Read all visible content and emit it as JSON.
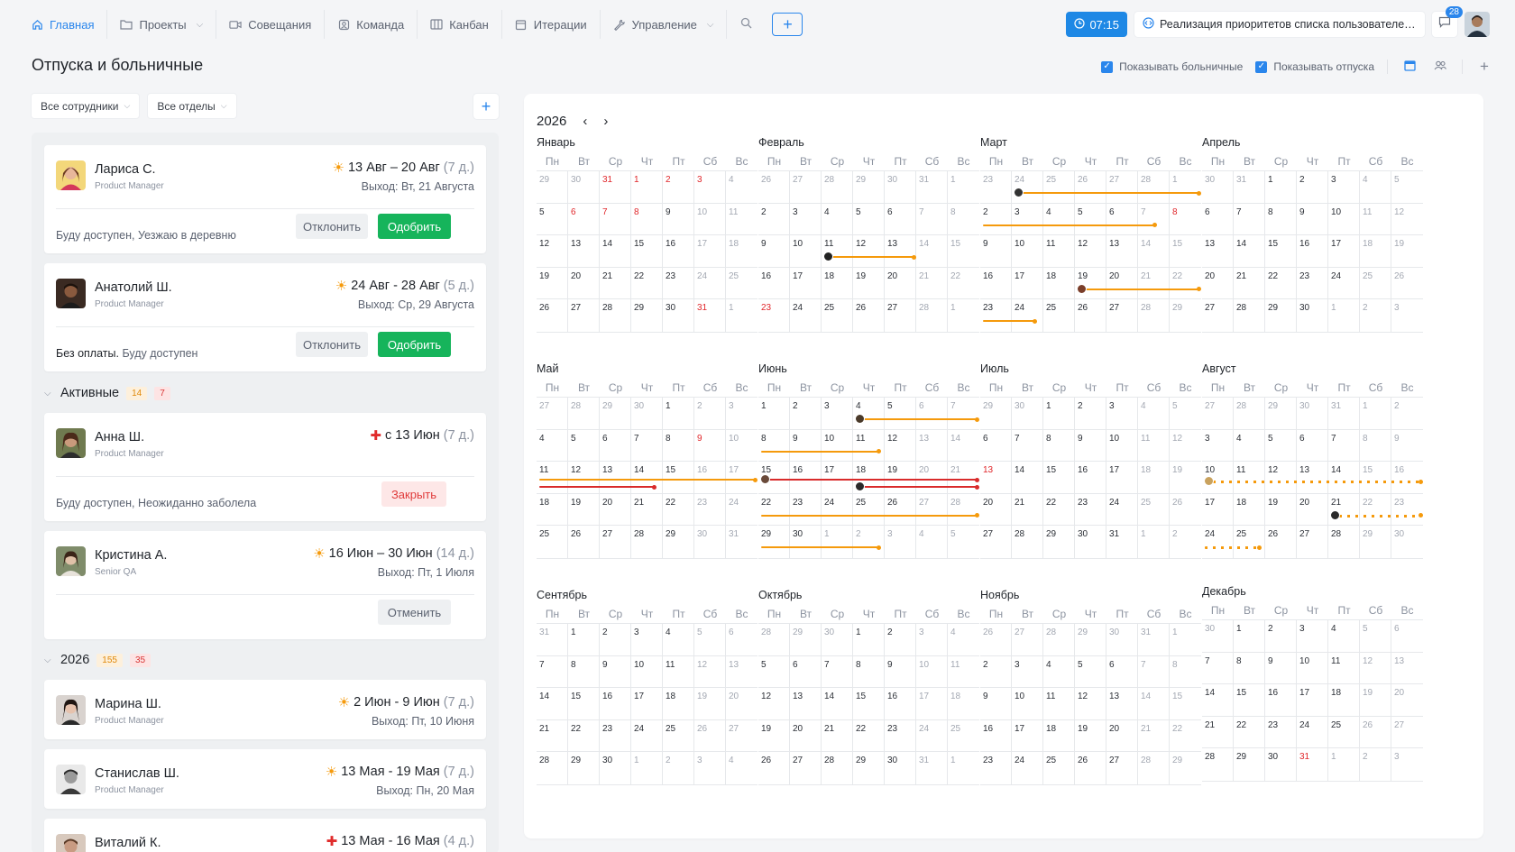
{
  "nav": {
    "items": [
      {
        "label": "Главная",
        "icon": "home-icon",
        "active": true
      },
      {
        "label": "Проекты",
        "icon": "folder-icon",
        "dropdown": true
      },
      {
        "label": "Совещания",
        "icon": "video-icon"
      },
      {
        "label": "Команда",
        "icon": "team-icon"
      },
      {
        "label": "Канбан",
        "icon": "kanban-icon"
      },
      {
        "label": "Итерации",
        "icon": "calendar-icon"
      },
      {
        "label": "Управление",
        "icon": "wrench-icon",
        "dropdown": true
      }
    ],
    "timer": "07:15",
    "current_task": "Реализация приоритетов списка пользователей д...",
    "notifications": "28"
  },
  "page": {
    "title": "Отпуска и больничные",
    "show_sick": "Показывать больничные",
    "show_vacations": "Показывать отпуска"
  },
  "filters": {
    "employees": "Все сотрудники",
    "departments": "Все отделы"
  },
  "pending": [
    {
      "name": "Лариса С.",
      "role": "Product Manager",
      "type": "vacation",
      "dates": "13 Авг – 20 Авг",
      "duration": "(7 д.)",
      "return": "Выход: Вт, 21 Августа",
      "note_prefix": "",
      "note": "Буду доступен, Уезжаю в деревню",
      "reject": "Отклонить",
      "approve": "Одобрить"
    },
    {
      "name": "Анатолий Ш.",
      "role": "Product Manager",
      "type": "vacation",
      "dates": "24 Авг - 28 Авг",
      "duration": "(5 д.)",
      "return": "Выход: Ср, 29 Августа",
      "note_prefix": "Без оплаты.",
      "note": " Буду доступен",
      "reject": "Отклонить",
      "approve": "Одобрить"
    }
  ],
  "groups": {
    "active": {
      "title": "Активные",
      "count_vac": "14",
      "count_sick": "7"
    },
    "year": {
      "title": "2026",
      "count_vac": "155",
      "count_sick": "35"
    }
  },
  "active_items": [
    {
      "name": "Анна Ш.",
      "role": "Product Manager",
      "type": "sick",
      "dates": "с 13 Июн",
      "duration": "(7 д.)",
      "note": "Буду доступен, Неожиданно заболела",
      "action": "Закрыть"
    },
    {
      "name": "Кристина А.",
      "role": "Senior QA",
      "type": "vacation",
      "dates": "16 Июн – 30 Июн",
      "duration": "(14 д.)",
      "return": "Выход: Пт, 1 Июля",
      "action": "Отменить"
    }
  ],
  "year_items": [
    {
      "name": "Марина Ш.",
      "role": "Product Manager",
      "type": "vacation",
      "dates": "2 Июн - 9 Июн",
      "duration": "(7 д.)",
      "return": "Выход: Пт, 10 Июня"
    },
    {
      "name": "Станислав Ш.",
      "role": "Product Manager",
      "type": "vacation",
      "dates": "13 Мая - 19 Мая",
      "duration": "(7 д.)",
      "return": "Выход: Пн, 20 Мая"
    },
    {
      "name": "Виталий К.",
      "role": "",
      "type": "sick",
      "dates": "13 Мая - 16 Мая",
      "duration": "(4 д.)",
      "return": ""
    }
  ],
  "calendar": {
    "year": "2026",
    "weekdays": [
      "Пн",
      "Вт",
      "Ср",
      "Чт",
      "Пт",
      "Сб",
      "Вс"
    ],
    "months": [
      "Январь",
      "Февраль",
      "Март",
      "Апрель",
      "Май",
      "Июнь",
      "Июль",
      "Август",
      "Сентябрь",
      "Октябрь",
      "Ноябрь",
      "Декабрь"
    ],
    "holidays": {
      "Январь": [
        31,
        1,
        2,
        3,
        6,
        7,
        8
      ],
      "Февраль": [
        23
      ],
      "Март": [
        8
      ],
      "Май": [
        9
      ],
      "Июль": [
        13
      ],
      "Декабрь": [
        31
      ]
    },
    "colors": {
      "vacation": "#f59a0c",
      "sick": "#d92b2b",
      "accent": "#2a86ec"
    }
  }
}
